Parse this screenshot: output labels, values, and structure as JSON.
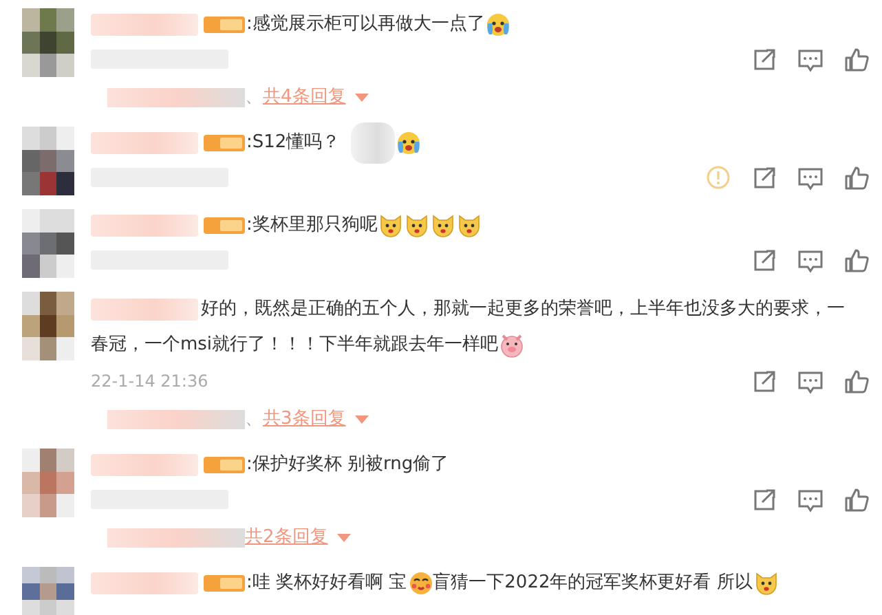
{
  "comments": [
    {
      "badge": true,
      "report": false,
      "lines": [
        [
          {
            "kind": "text",
            "text": ":感觉展示柜可以再做大一点了"
          },
          {
            "kind": "cry_emoji"
          }
        ]
      ],
      "replies": {
        "prefix": "、",
        "text": "共4条回复"
      }
    },
    {
      "badge": true,
      "report": true,
      "lines": [
        [
          {
            "kind": "text",
            "text": ":S12懂吗？"
          },
          {
            "kind": "blur"
          },
          {
            "kind": "cry_emoji"
          }
        ]
      ]
    },
    {
      "badge": true,
      "report": false,
      "lines": [
        [
          {
            "kind": "text",
            "text": ":奖杯里那只狗呢"
          },
          {
            "kind": "dog_emoji"
          },
          {
            "kind": "dog_emoji"
          },
          {
            "kind": "dog_emoji"
          },
          {
            "kind": "dog_emoji"
          }
        ]
      ]
    },
    {
      "badge": false,
      "report": false,
      "lines": [
        [
          {
            "kind": "text",
            "text": "好的，既然是正确的五个人，那就一起更多的荣誉吧，上半年也没多大的要求，一"
          }
        ],
        [
          {
            "kind": "text",
            "text": "春冠，一个msi就行了！！！下半年就跟去年一样吧"
          },
          {
            "kind": "pig_emoji"
          }
        ]
      ],
      "time": "22-1-14 21:36",
      "replies": {
        "prefix": "、",
        "text": "共3条回复"
      }
    },
    {
      "badge": true,
      "report": false,
      "lines": [
        [
          {
            "kind": "text",
            "text": ":保护好奖杯 别被rng偷了"
          }
        ]
      ],
      "replies": {
        "text": "共2条回复"
      }
    },
    {
      "badge": true,
      "report": false,
      "lines": [
        [
          {
            "kind": "text",
            "text": ":哇 奖杯好好看啊 宝"
          },
          {
            "kind": "kiss_emoji"
          },
          {
            "kind": "text",
            "text": "盲猜一下2022年的冠军奖杯更好看 所以"
          },
          {
            "kind": "dog_emoji"
          }
        ]
      ]
    }
  ]
}
